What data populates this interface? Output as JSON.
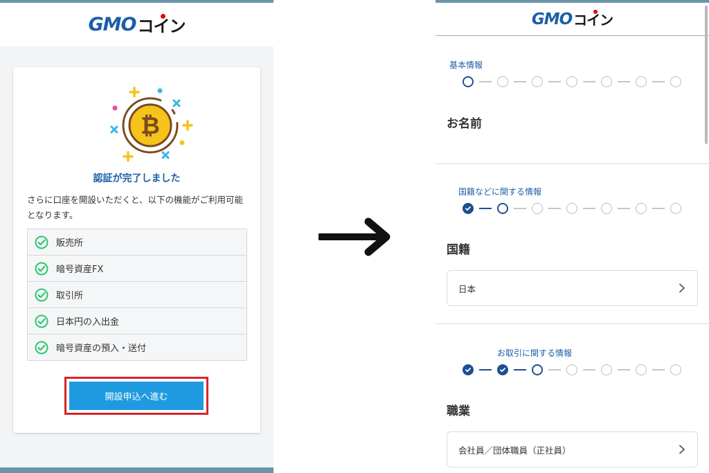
{
  "brand": {
    "logo_gmo": "GMO",
    "logo_coin": "コイン"
  },
  "left": {
    "card": {
      "title": "認証が完了しました",
      "description": "さらに口座を開設いただくと、以下の機能がご利用可能となります。",
      "features": [
        {
          "label": "販売所"
        },
        {
          "label": "暗号資産FX"
        },
        {
          "label": "取引所"
        },
        {
          "label": "日本円の入出金"
        },
        {
          "label": "暗号資産の預入・送付"
        }
      ],
      "cta_label": "開設申込へ進む"
    }
  },
  "right": {
    "sections": [
      {
        "step_label": "基本情報",
        "heading": "お名前",
        "steps": [
          "current",
          "todo",
          "todo",
          "todo",
          "todo",
          "todo",
          "todo"
        ]
      },
      {
        "step_label": "国籍などに関する情報",
        "heading": "国籍",
        "select_value": "日本",
        "steps": [
          "done",
          "current",
          "todo",
          "todo",
          "todo",
          "todo",
          "todo"
        ]
      },
      {
        "step_label": "お取引に関する情報",
        "heading": "職業",
        "select_value": "会社員／団体職員（正社員）",
        "steps": [
          "done",
          "done",
          "current",
          "todo",
          "todo",
          "todo",
          "todo"
        ]
      }
    ]
  },
  "colors": {
    "brand_blue": "#1c5ea8",
    "cta_blue": "#1e9be0",
    "highlight_red": "#d8252a",
    "check_green": "#2cc86f",
    "step_active": "#1c4f93",
    "strip": "#6b93ab"
  },
  "icons": {
    "coin": "bitcoin-coin-illustration",
    "feature_check": "check-circle-icon",
    "select_chevron": "chevron-right-icon",
    "flow_arrow": "right-arrow-icon"
  }
}
